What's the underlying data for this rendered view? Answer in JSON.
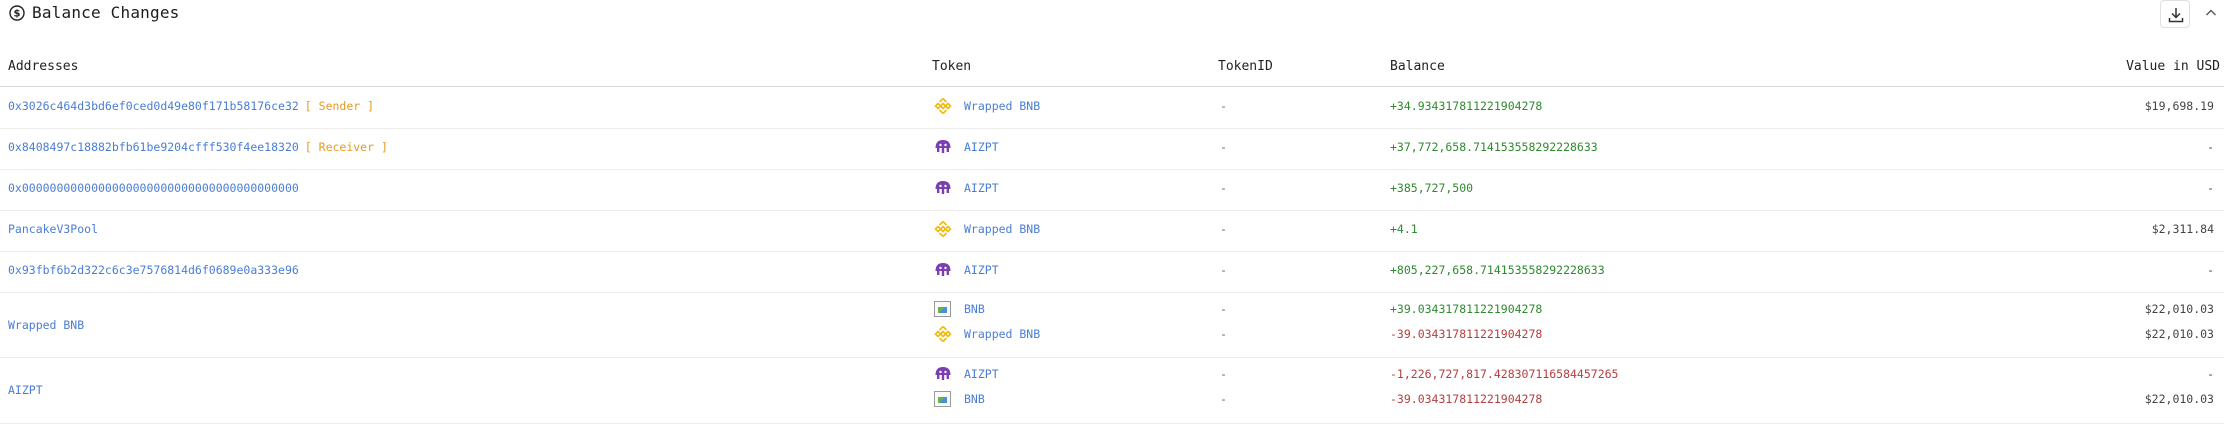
{
  "section": {
    "title": "Balance Changes"
  },
  "colors": {
    "accent": "#4a7dd6",
    "positive": "#2f8a2f",
    "negative": "#b33f3f",
    "role": "#e59b1e"
  },
  "table": {
    "headers": {
      "addresses": "Addresses",
      "token": "Token",
      "token_id": "TokenID",
      "balance": "Balance",
      "value_usd": "Value in USD"
    },
    "rows": [
      {
        "address": "0x3026c464d3bd6ef0ced0d49e80f171b58176ce32",
        "role": "[ Sender ]",
        "entries": [
          {
            "token": "Wrapped BNB",
            "icon": "bnb-icon",
            "token_id": "-",
            "balance": "+34.934317811221904278",
            "sign": "pos",
            "usd": "$19,698.19"
          }
        ]
      },
      {
        "address": "0x8408497c18882bfb61be9204cfff530f4ee18320",
        "role": "[ Receiver ]",
        "entries": [
          {
            "token": "AIZPT",
            "icon": "aizpt-icon",
            "token_id": "-",
            "balance": "+37,772,658.714153558292228633",
            "sign": "pos",
            "usd": "-"
          }
        ]
      },
      {
        "address": "0x0000000000000000000000000000000000000000",
        "role": "",
        "entries": [
          {
            "token": "AIZPT",
            "icon": "aizpt-icon",
            "token_id": "-",
            "balance": "+385,727,500",
            "sign": "pos",
            "usd": "-"
          }
        ]
      },
      {
        "address": "PancakeV3Pool",
        "role": "",
        "entries": [
          {
            "token": "Wrapped BNB",
            "icon": "bnb-icon",
            "token_id": "-",
            "balance": "+4.1",
            "sign": "pos",
            "usd": "$2,311.84"
          }
        ]
      },
      {
        "address": "0x93fbf6b2d322c6c3e7576814d6f0689e0a333e96",
        "role": "",
        "entries": [
          {
            "token": "AIZPT",
            "icon": "aizpt-icon",
            "token_id": "-",
            "balance": "+805,227,658.714153558292228633",
            "sign": "pos",
            "usd": "-"
          }
        ]
      },
      {
        "address": "Wrapped BNB",
        "role": "",
        "entries": [
          {
            "token": "BNB",
            "icon": "broken-image-icon",
            "token_id": "-",
            "balance": "+39.034317811221904278",
            "sign": "pos",
            "usd": "$22,010.03"
          },
          {
            "token": "Wrapped BNB",
            "icon": "bnb-icon",
            "token_id": "-",
            "balance": "-39.034317811221904278",
            "sign": "neg",
            "usd": "$22,010.03"
          }
        ]
      },
      {
        "address": "AIZPT",
        "role": "",
        "entries": [
          {
            "token": "AIZPT",
            "icon": "aizpt-icon",
            "token_id": "-",
            "balance": "-1,226,727,817.428307116584457265",
            "sign": "neg",
            "usd": "-"
          },
          {
            "token": "BNB",
            "icon": "broken-image-icon",
            "token_id": "-",
            "balance": "-39.034317811221904278",
            "sign": "neg",
            "usd": "$22,010.03"
          }
        ]
      }
    ]
  }
}
